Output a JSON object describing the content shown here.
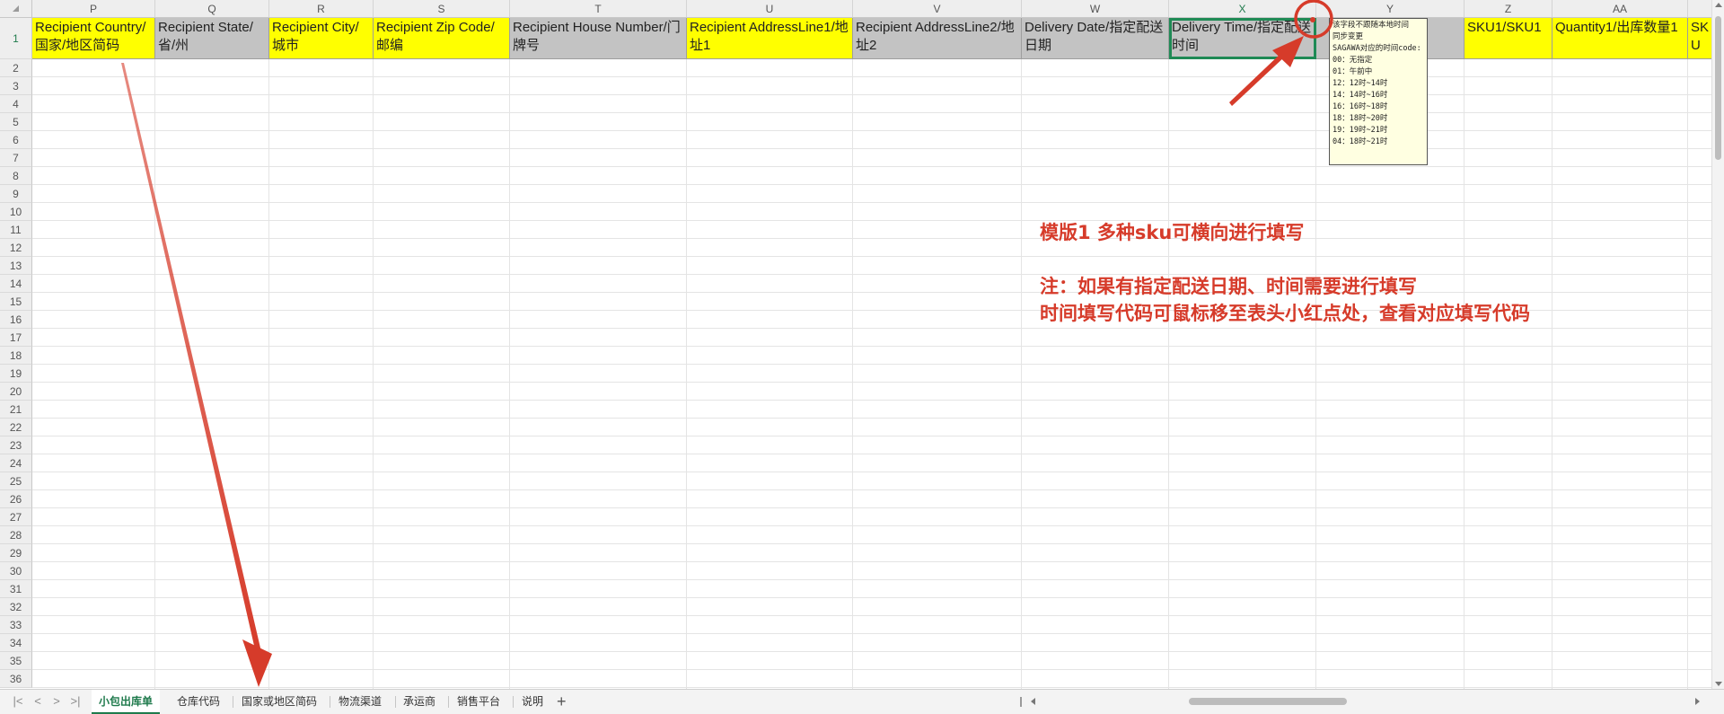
{
  "columns": [
    "P",
    "Q",
    "R",
    "S",
    "T",
    "U",
    "V",
    "W",
    "X",
    "Y",
    "Z",
    "AA",
    ""
  ],
  "active_column": "X",
  "row_numbers": [
    "1",
    "2",
    "3",
    "4",
    "5",
    "6",
    "7",
    "8",
    "9",
    "10",
    "11",
    "12",
    "13",
    "14",
    "15",
    "16",
    "17",
    "18",
    "19",
    "20",
    "21",
    "22",
    "23",
    "24",
    "25",
    "26",
    "27",
    "28",
    "29",
    "30",
    "31",
    "32",
    "33",
    "34",
    "35",
    "36"
  ],
  "header_cells": [
    {
      "text": "Recipient Country/国家/地区简码",
      "fill": "yellow"
    },
    {
      "text": "Recipient State/省/州",
      "fill": "gray"
    },
    {
      "text": "Recipient City/城市",
      "fill": "yellow"
    },
    {
      "text": "Recipient Zip Code/邮编",
      "fill": "yellow"
    },
    {
      "text": "Recipient House Number/门牌号",
      "fill": "gray"
    },
    {
      "text": "Recipient AddressLine1/地址1",
      "fill": "yellow"
    },
    {
      "text": "Recipient AddressLine2/地址2",
      "fill": "gray"
    },
    {
      "text": "Delivery Date/指定配送日期",
      "fill": "gray"
    },
    {
      "text": "Delivery Time/指定配送时间",
      "fill": "gray"
    },
    {
      "text": "",
      "fill": "gray"
    },
    {
      "text": "SKU1/SKU1",
      "fill": "yellow"
    },
    {
      "text": "Quantity1/出库数量1",
      "fill": "yellow"
    },
    {
      "text": "SKU",
      "fill": "yellow"
    }
  ],
  "comment": {
    "lines": [
      "该字段不跟随本地时间",
      "同步变更",
      "SAGAWA对应的时间code:",
      "00：无指定",
      "01：午前中",
      "12：12时~14时",
      "14：14时~16时",
      "16：16时~18时",
      "18：18时~20时",
      "19：19时~21时",
      "04：18时~21时"
    ]
  },
  "annotations": {
    "line1": "模版1 多种sku可横向进行填写",
    "line2": "注：如果有指定配送日期、时间需要进行填写",
    "line3": "时间填写代码可鼠标移至表头小红点处，查看对应填写代码"
  },
  "sheet_tabs": [
    "小包出库单",
    "仓库代码",
    "国家或地区简码",
    "物流渠道",
    "承运商",
    "销售平台",
    "说明"
  ],
  "active_tab": "小包出库单",
  "nav_buttons": {
    "first": "|<",
    "prev": "<",
    "next": ">",
    "last": ">|",
    "add": "+"
  },
  "colors": {
    "header_yellow": "#ffff00",
    "header_gray": "#c3c3c3",
    "annotation_red": "#d63b2a",
    "selection_green": "#1f8a55"
  }
}
